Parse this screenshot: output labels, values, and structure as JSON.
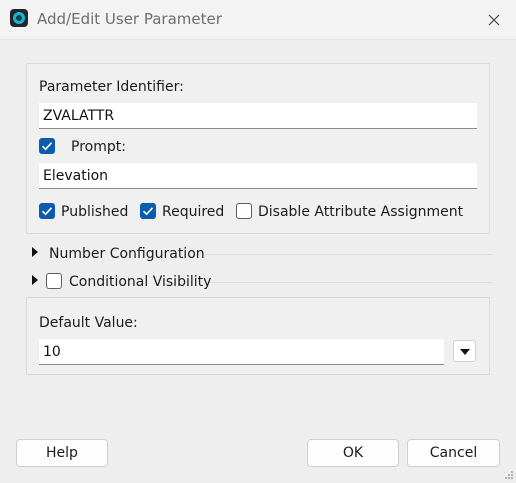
{
  "window": {
    "title": "Add/Edit User Parameter"
  },
  "identifier": {
    "label": "Parameter Identifier:",
    "value": "ZVALATTR"
  },
  "prompt": {
    "label": "Prompt:",
    "checked": true,
    "value": "Elevation"
  },
  "options": [
    {
      "label": "Published",
      "checked": true
    },
    {
      "label": "Required",
      "checked": true
    },
    {
      "label": "Disable Attribute Assignment",
      "checked": false
    }
  ],
  "sections": {
    "number_config": "Number Configuration",
    "conditional_visibility": {
      "label": "Conditional Visibility",
      "checked": false
    }
  },
  "default_value": {
    "label": "Default Value:",
    "value": "10"
  },
  "buttons": {
    "help": "Help",
    "ok": "OK",
    "cancel": "Cancel"
  },
  "icons": [
    "app-icon",
    "close-icon",
    "checkmark-icon",
    "expand-arrow-icon",
    "dropdown-arrow-icon",
    "resize-grip-icon"
  ],
  "colors": {
    "accent": "#0b5cad",
    "app_icon": "#19b5cf"
  }
}
